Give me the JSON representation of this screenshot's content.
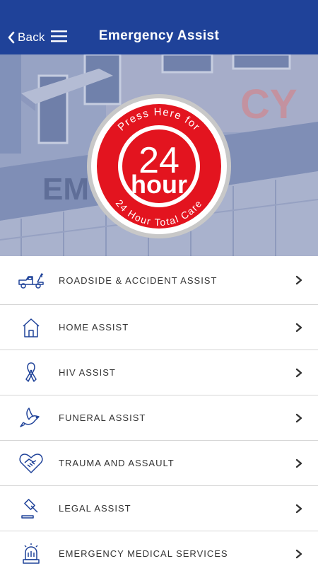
{
  "header": {
    "back_label": "Back",
    "title": "Emergency Assist"
  },
  "hero": {
    "badge_top_text": "Press Here for",
    "badge_number": "24",
    "badge_word": "hour",
    "badge_bottom_text": "24 Hour Total Care",
    "background_sign_left": "EM",
    "background_sign_right": "CY"
  },
  "colors": {
    "nav": "#1f4299",
    "badge_red": "#e3141f",
    "icon_blue": "#1f4299"
  },
  "menu": [
    {
      "label": "ROADSIDE & ACCIDENT ASSIST",
      "icon": "tow-truck-icon"
    },
    {
      "label": "HOME ASSIST",
      "icon": "house-icon"
    },
    {
      "label": "HIV ASSIST",
      "icon": "awareness-ribbon-icon"
    },
    {
      "label": "FUNERAL ASSIST",
      "icon": "dove-icon"
    },
    {
      "label": "TRAUMA AND ASSAULT",
      "icon": "heart-handshake-icon"
    },
    {
      "label": "LEGAL ASSIST",
      "icon": "gavel-icon"
    },
    {
      "label": "EMERGENCY MEDICAL SERVICES",
      "icon": "siren-icon"
    }
  ]
}
